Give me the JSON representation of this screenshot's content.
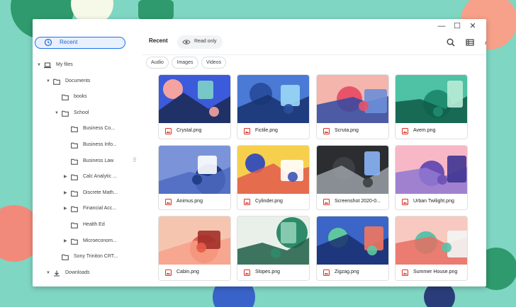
{
  "colors": {
    "accent": "#1a73e8",
    "wallpaper": "#7fd6c2",
    "image_icon": "#d93025"
  },
  "sidebar": {
    "recent_label": "Recent",
    "tree": [
      {
        "label": "My files",
        "depth": 0,
        "icon": "laptop-icon",
        "arrow": "expanded"
      },
      {
        "label": "Documents",
        "depth": 1,
        "icon": "folder-icon",
        "arrow": "expanded"
      },
      {
        "label": "books",
        "depth": 2,
        "icon": "folder-icon",
        "arrow": "none"
      },
      {
        "label": "School",
        "depth": 2,
        "icon": "folder-icon",
        "arrow": "expanded"
      },
      {
        "label": "Business Co...",
        "depth": 3,
        "icon": "folder-icon",
        "arrow": "none"
      },
      {
        "label": "Business Info...",
        "depth": 3,
        "icon": "folder-icon",
        "arrow": "none"
      },
      {
        "label": "Business Law",
        "depth": 3,
        "icon": "folder-icon",
        "arrow": "none"
      },
      {
        "label": "Calc Analytic ...",
        "depth": 3,
        "icon": "folder-icon",
        "arrow": "collapsed"
      },
      {
        "label": "Discrete Math...",
        "depth": 3,
        "icon": "folder-icon",
        "arrow": "collapsed"
      },
      {
        "label": "Financial Acc...",
        "depth": 3,
        "icon": "folder-icon",
        "arrow": "collapsed"
      },
      {
        "label": "Health Ed",
        "depth": 3,
        "icon": "folder-icon",
        "arrow": "none"
      },
      {
        "label": "Microeconom...",
        "depth": 3,
        "icon": "folder-icon",
        "arrow": "collapsed"
      },
      {
        "label": "Sony Triniton CRT...",
        "depth": 2,
        "icon": "folder-icon",
        "arrow": "none"
      },
      {
        "label": "Downloads",
        "depth": 1,
        "icon": "download-icon",
        "arrow": "expanded"
      }
    ]
  },
  "toolbar": {
    "breadcrumb": "Recent",
    "read_only_label": "Read only",
    "icons": [
      "search-icon",
      "list-view-icon",
      "sort-az-icon",
      "more-vert-icon"
    ]
  },
  "filters": [
    "Audio",
    "Images",
    "Videos"
  ],
  "files": [
    {
      "name": "Crystal.png",
      "palette": [
        "#3b5bdb",
        "#f4a3a0",
        "#7fd0c8",
        "#1b2a52"
      ]
    },
    {
      "name": "Fictile.png",
      "palette": [
        "#4a7ad6",
        "#2a4fa0",
        "#9ad8f5",
        "#17326e"
      ]
    },
    {
      "name": "Scruta.png",
      "palette": [
        "#f3b5ac",
        "#e8536a",
        "#6b8ed8",
        "#2f4aa2"
      ]
    },
    {
      "name": "Avem.png",
      "palette": [
        "#4fc1a4",
        "#1f8c70",
        "#b8ecd8",
        "#0f5a48"
      ]
    },
    {
      "name": "Animus.png",
      "palette": [
        "#7b93d8",
        "#1d3a82",
        "#ffffff",
        "#4d6bc2"
      ]
    },
    {
      "name": "Cylinder.png",
      "palette": [
        "#f6d04d",
        "#3d52b5",
        "#ffffff",
        "#e25c4f"
      ]
    },
    {
      "name": "Screenshot 2020-0...",
      "palette": [
        "#2b2d31",
        "#3c4043",
        "#8ab4f8",
        "#9aa0a6"
      ]
    },
    {
      "name": "Urban Twilight.png",
      "palette": [
        "#f7b7c7",
        "#6c4fb3",
        "#3e3591",
        "#8f78d1"
      ]
    },
    {
      "name": "Cabin.png",
      "palette": [
        "#f6c5b0",
        "#e75c48",
        "#a2302b",
        "#f7a08a"
      ]
    },
    {
      "name": "Slopes.png",
      "palette": [
        "#e9f0ea",
        "#2e8b6a",
        "#8fcfb6",
        "#1f5e47"
      ]
    },
    {
      "name": "Zigzag.png",
      "palette": [
        "#3b65c7",
        "#5fc7a0",
        "#f2755f",
        "#1a2e6e"
      ]
    },
    {
      "name": "Summer House.png",
      "palette": [
        "#f7c9c0",
        "#5bc1a9",
        "#f2f6f5",
        "#e86f63"
      ]
    }
  ]
}
